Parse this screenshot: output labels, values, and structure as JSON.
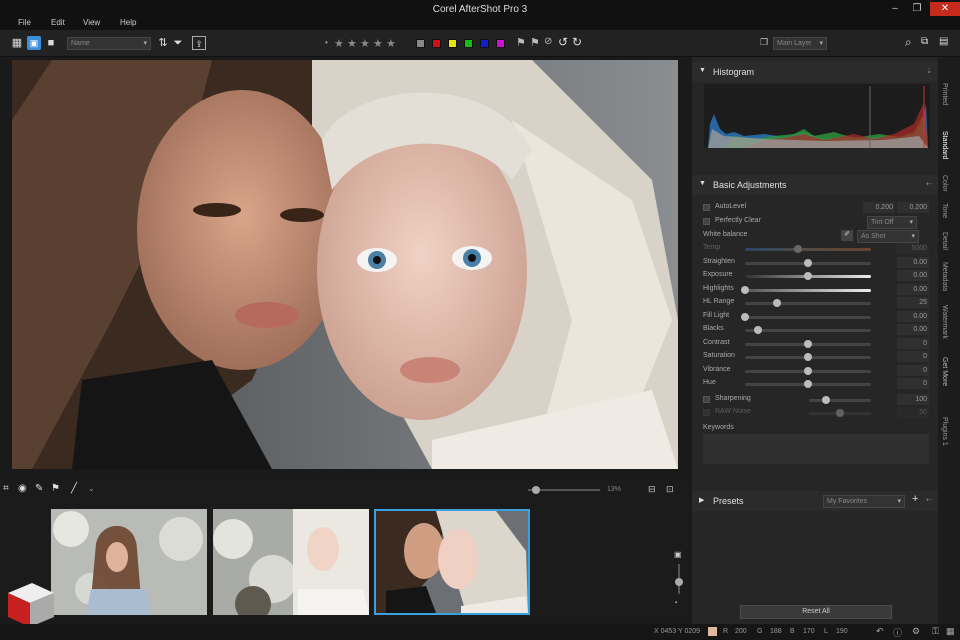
{
  "app": {
    "title": "Corel AfterShot Pro 3"
  },
  "menu": [
    "File",
    "Edit",
    "View",
    "Help"
  ],
  "toolbar": {
    "sort_select": "Name",
    "layer_select": "Main Layer",
    "color_labels": [
      "#888888",
      "#d01010",
      "#e6e600",
      "#10c010",
      "#1020d0",
      "#d010d0"
    ]
  },
  "viewer": {
    "zoom": "13%"
  },
  "histogram": {
    "title": "Histogram"
  },
  "basic": {
    "title": "Basic Adjustments",
    "autolevel": {
      "label": "AutoLevel",
      "v1": "0.200",
      "v2": "0.200"
    },
    "perfect_clear": {
      "label": "Perfectly Clear",
      "select": "Tint Off"
    },
    "white_balance": {
      "label": "White balance",
      "select": "As Shot"
    },
    "sliders": [
      {
        "label": "Temp",
        "value": "5000",
        "pos": 0.42,
        "disabled": true
      },
      {
        "label": "Straighten",
        "value": "0.00",
        "pos": 0.5
      },
      {
        "label": "Exposure",
        "value": "0.00",
        "pos": 0.5
      },
      {
        "label": "Highlights",
        "value": "0.00",
        "pos": 0.0
      },
      {
        "label": "HL Range",
        "value": "25",
        "pos": 0.25
      },
      {
        "label": "Fill Light",
        "value": "0.00",
        "pos": 0.0
      },
      {
        "label": "Blacks",
        "value": "0.00",
        "pos": 0.1
      },
      {
        "label": "Contrast",
        "value": "0",
        "pos": 0.5
      },
      {
        "label": "Saturation",
        "value": "0",
        "pos": 0.5
      },
      {
        "label": "Vibrance",
        "value": "0",
        "pos": 0.5
      },
      {
        "label": "Hue",
        "value": "0",
        "pos": 0.5
      }
    ],
    "sharpening": {
      "label": "Sharpening",
      "value": "100",
      "pos": 0.28
    },
    "raw_noise": {
      "label": "RAW Noise",
      "value": "50",
      "pos": 0.5
    },
    "keywords": "Keywords"
  },
  "presets": {
    "title": "Presets",
    "select": "My Favorites"
  },
  "reset_all": "Reset All",
  "side_tabs": [
    "Printed",
    "Standard",
    "Color",
    "Tone",
    "Detail",
    "Metadata",
    "Watermark",
    "Get More",
    "Plugins 1"
  ],
  "status": {
    "x": "X 0453",
    "y": "Y 0209",
    "r_label": "R",
    "r": "200",
    "g_label": "G",
    "g": "188",
    "b_label": "B",
    "b": "170",
    "l_label": "L",
    "l": "190"
  }
}
